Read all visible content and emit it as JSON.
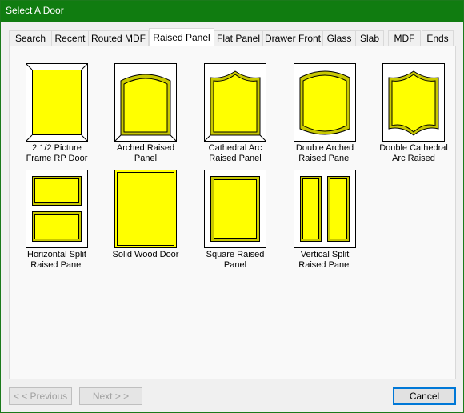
{
  "window": {
    "title": "Select A Door"
  },
  "tabs": [
    "Search",
    "Recent",
    "Routed MDF",
    "Raised Panel",
    "Flat Panel",
    "Drawer Front",
    "Glass",
    "Slab",
    "MDF",
    "Ends"
  ],
  "active_tab": "Raised Panel",
  "doors": [
    {
      "line1": "2 1/2 Picture",
      "line2": "Frame RP Door"
    },
    {
      "line1": "Arched Raised",
      "line2": "Panel"
    },
    {
      "line1": "Cathedral Arc",
      "line2": "Raised Panel"
    },
    {
      "line1": "Double Arched",
      "line2": "Raised Panel"
    },
    {
      "line1": "Double Cathedral",
      "line2": "Arc Raised"
    },
    {
      "line1": "Horizontal Split",
      "line2": "Raised Panel"
    },
    {
      "line1": "Solid Wood Door",
      "line2": ""
    },
    {
      "line1": "Square Raised",
      "line2": "Panel"
    },
    {
      "line1": "Vertical Split",
      "line2": "Raised Panel"
    }
  ],
  "buttons": {
    "previous": "< < Previous",
    "next": "Next > >",
    "cancel": "Cancel"
  },
  "colors": {
    "panel_fill": "#ffff00",
    "titlebar": "#107c10",
    "frame": "#ffffff"
  }
}
